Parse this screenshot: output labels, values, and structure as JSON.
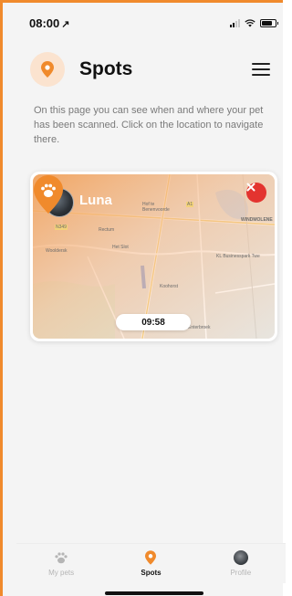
{
  "status_bar": {
    "time": "08:00",
    "location_arrow": "↗"
  },
  "header": {
    "title": "Spots",
    "badge_icon": "location-pin-icon",
    "menu_icon": "hamburger-menu-icon"
  },
  "intro_text": "On this page you can see when and where your pet has been scanned. Click on the location to navigate there.",
  "spot": {
    "pet_name": "Luna",
    "time": "09:58",
    "map_labels": {
      "hof": "Hof te\nBenenvoorde",
      "windmolen": "WINDMOLENE",
      "rectum": "Rectum",
      "het_slot": "Het Slot",
      "wooldersk": "Wooldersk",
      "kl": "KL Businesspark Twe",
      "koohorst": "Koohorst",
      "enterbroek": "Enterbroek",
      "n": "N349",
      "a1": "A1"
    }
  },
  "tabs": [
    {
      "label": "My pets",
      "icon": "paw-icon",
      "active": false
    },
    {
      "label": "Spots",
      "icon": "location-pin-icon",
      "active": true
    },
    {
      "label": "Profile",
      "icon": "profile-avatar",
      "active": false
    }
  ],
  "colors": {
    "accent": "#f08a2c",
    "close": "#e3342f",
    "muted": "#7a7a7a"
  }
}
